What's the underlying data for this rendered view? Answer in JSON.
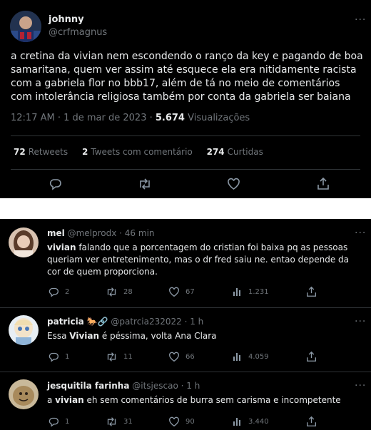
{
  "main_tweet": {
    "name": "johnny",
    "handle": "@crfmagnus",
    "text": "a cretina da vivian nem escondendo o ranço da key e pagando de boa samaritana, quem ver assim até esquece ela era nitidamente racista com a gabriela flor no bbb17, além de tá no meio de comentários com intolerância religiosa também por conta da gabriela ser baiana",
    "time": "12:17 AM · 1 de mar de 2023 · ",
    "views_count": "5.674",
    "views_label": " Visualizações",
    "retweets_count": "72",
    "retweets_label": "Retweets",
    "quotes_count": "2",
    "quotes_label": "Tweets com comentário",
    "likes_count": "274",
    "likes_label": "Curtidas",
    "more": "···"
  },
  "replies": [
    {
      "name": "mel",
      "handle": "@melprodx · 46 min",
      "text_bold": "vivian",
      "text": " falando que a porcentagem do cristian foi baixa pq as pessoas queriam ver entretenimento, mas o dr fred saiu ne. entao depende da cor de quem proporciona.",
      "replies": "2",
      "retweets": "28",
      "likes": "67",
      "views": "1.231"
    },
    {
      "name": "patricia",
      "handle": "@patrcia232022 · 1 h",
      "text_pre": "Essa ",
      "text_bold": "Vivian",
      "text": " é péssima, volta Ana Clara",
      "replies": "1",
      "retweets": "11",
      "likes": "66",
      "views": "4.059"
    },
    {
      "name": "jesquitila farinha",
      "handle": "@itsjescao · 1 h",
      "text_pre": "a ",
      "text_bold": "vivian",
      "text": " eh sem comentários de burra sem carisma e incompetente",
      "replies": "1",
      "retweets": "31",
      "likes": "90",
      "views": "3.440"
    }
  ],
  "colors": {
    "background": "#000000",
    "text": "#e7e9ea",
    "muted": "#71767b",
    "divider": "#2f3336"
  }
}
